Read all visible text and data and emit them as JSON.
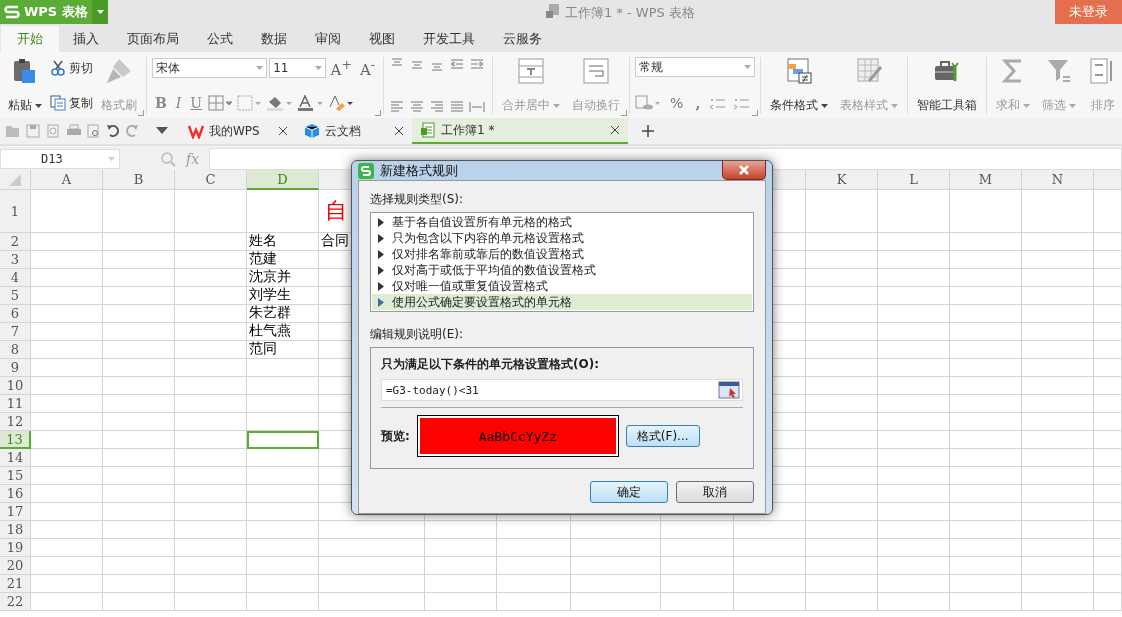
{
  "app": {
    "logo": "WPS 表格",
    "title": "工作簿1 * - WPS 表格",
    "login": "未登录"
  },
  "menu_tabs": [
    {
      "label": "开始",
      "selected": true
    },
    {
      "label": "插入",
      "selected": false
    },
    {
      "label": "页面布局",
      "selected": false
    },
    {
      "label": "公式",
      "selected": false
    },
    {
      "label": "数据",
      "selected": false
    },
    {
      "label": "审阅",
      "selected": false
    },
    {
      "label": "视图",
      "selected": false
    },
    {
      "label": "开发工具",
      "selected": false
    },
    {
      "label": "云服务",
      "selected": false
    }
  ],
  "ribbon": {
    "clipboard": [
      {
        "label": "粘贴",
        "kind": "paste",
        "disabled": false,
        "dropdown": true
      },
      {
        "label": "剪切",
        "kind": "cut",
        "disabled": false,
        "dropdown": false
      },
      {
        "label": "复制",
        "kind": "copy",
        "disabled": false,
        "dropdown": false
      },
      {
        "label": "格式刷",
        "kind": "painter",
        "disabled": true,
        "dropdown": false
      }
    ],
    "font": {
      "name": "宋体",
      "size": "11",
      "grow": "A$^{+}$",
      "shrink": "A$^{-}$",
      "bold": "B",
      "italic": "I",
      "underline": "U"
    },
    "align_buttons": [
      {
        "label": "合并居中",
        "kind": "merge",
        "disabled": true,
        "dropdown": true
      },
      {
        "label": "自动换行",
        "kind": "wrap",
        "disabled": true,
        "dropdown": false
      }
    ],
    "number": {
      "format": "常规",
      "percent": "%",
      "comma": ","
    },
    "style_buttons": [
      {
        "label": "条件格式",
        "kind": "conditional",
        "disabled": false,
        "dropdown": true
      },
      {
        "label": "表格样式",
        "kind": "table-style",
        "disabled": true,
        "dropdown": true
      }
    ],
    "tool_buttons": [
      {
        "label": "智能工具箱",
        "kind": "toolbox",
        "disabled": false,
        "dropdown": false
      }
    ],
    "edit_buttons": [
      {
        "label": "求和",
        "kind": "sum",
        "disabled": true,
        "dropdown": true
      },
      {
        "label": "筛选",
        "kind": "filter",
        "disabled": true,
        "dropdown": true
      },
      {
        "label": "排序",
        "kind": "sort",
        "disabled": true,
        "dropdown": false
      }
    ]
  },
  "doc_tabs": [
    {
      "label": "我的WPS",
      "kind": "wps",
      "selected": false
    },
    {
      "label": "云文档",
      "kind": "cloud",
      "selected": false
    },
    {
      "label": "工作簿1 *",
      "kind": "sheet",
      "selected": true
    }
  ],
  "formula_bar": {
    "name_box": "D13",
    "fx": "fx"
  },
  "sheet": {
    "columns": [
      {
        "label": "A",
        "selected": false
      },
      {
        "label": "B",
        "selected": false
      },
      {
        "label": "C",
        "selected": false
      },
      {
        "label": "D",
        "selected": true
      },
      {
        "selected": false
      },
      {},
      {},
      {},
      {},
      {
        "selected": false
      },
      {
        "label": "K",
        "selected": false
      },
      {
        "label": "L",
        "selected": false
      },
      {
        "label": "M",
        "selected": false
      },
      {
        "label": "N",
        "selected": false
      },
      {
        "selected": false
      }
    ],
    "rows": [
      {
        "label": "1",
        "selected": false,
        "kind": "title",
        "cells": {
          "col_5": "自"
        }
      },
      {
        "label": "2",
        "selected": false,
        "kind": "data",
        "cells": {
          "col_4": "姓名",
          "col_5": "合同"
        }
      },
      {
        "label": "3",
        "selected": false,
        "kind": "data",
        "cells": {
          "col_4": "范建"
        }
      },
      {
        "label": "4",
        "selected": false,
        "kind": "data",
        "cells": {
          "col_4": "沈京并"
        }
      },
      {
        "label": "5",
        "selected": false,
        "kind": "data",
        "cells": {
          "col_4": "刘学生"
        }
      },
      {
        "label": "6",
        "selected": false,
        "kind": "data",
        "cells": {
          "col_4": "朱艺群"
        }
      },
      {
        "label": "7",
        "selected": false,
        "kind": "data",
        "cells": {
          "col_4": "杜气燕"
        }
      },
      {
        "label": "8",
        "selected": false,
        "kind": "data",
        "cells": {
          "col_4": "范同"
        }
      },
      {
        "label": "9",
        "selected": false
      },
      {
        "label": "10",
        "selected": false
      },
      {
        "label": "11",
        "selected": false
      },
      {
        "label": "12",
        "selected": false
      },
      {
        "label": "13",
        "selected": true
      },
      {
        "label": "14",
        "selected": false
      },
      {
        "label": "15",
        "selected": false
      },
      {
        "label": "16",
        "selected": false
      },
      {
        "label": "17",
        "selected": false
      },
      {
        "label": "18",
        "selected": false
      },
      {
        "label": "19",
        "selected": false
      },
      {
        "label": "20",
        "selected": false
      },
      {
        "label": "21",
        "selected": false
      },
      {
        "label": "22",
        "selected": false
      }
    ]
  },
  "dialog": {
    "title": "新建格式规则",
    "rule_type_label": "选择规则类型(S):",
    "rule_types": [
      {
        "label": "基于各自值设置所有单元格的格式",
        "selected": false
      },
      {
        "label": "只为包含以下内容的单元格设置格式",
        "selected": false
      },
      {
        "label": "仅对排名靠前或靠后的数值设置格式",
        "selected": false
      },
      {
        "label": "仅对高于或低于平均值的数值设置格式",
        "selected": false
      },
      {
        "label": "仅对唯一值或重复值设置格式",
        "selected": false
      },
      {
        "label": "使用公式确定要设置格式的单元格",
        "selected": true
      }
    ],
    "description_label": "编辑规则说明(E):",
    "condition_label": "只为满足以下条件的单元格设置格式(O):",
    "formula": "=G3-today()<31",
    "preview_label": "预览:",
    "preview_text": "AaBbCcYyZz",
    "format_button": "格式(F)...",
    "ok": "确定",
    "cancel": "取消"
  }
}
